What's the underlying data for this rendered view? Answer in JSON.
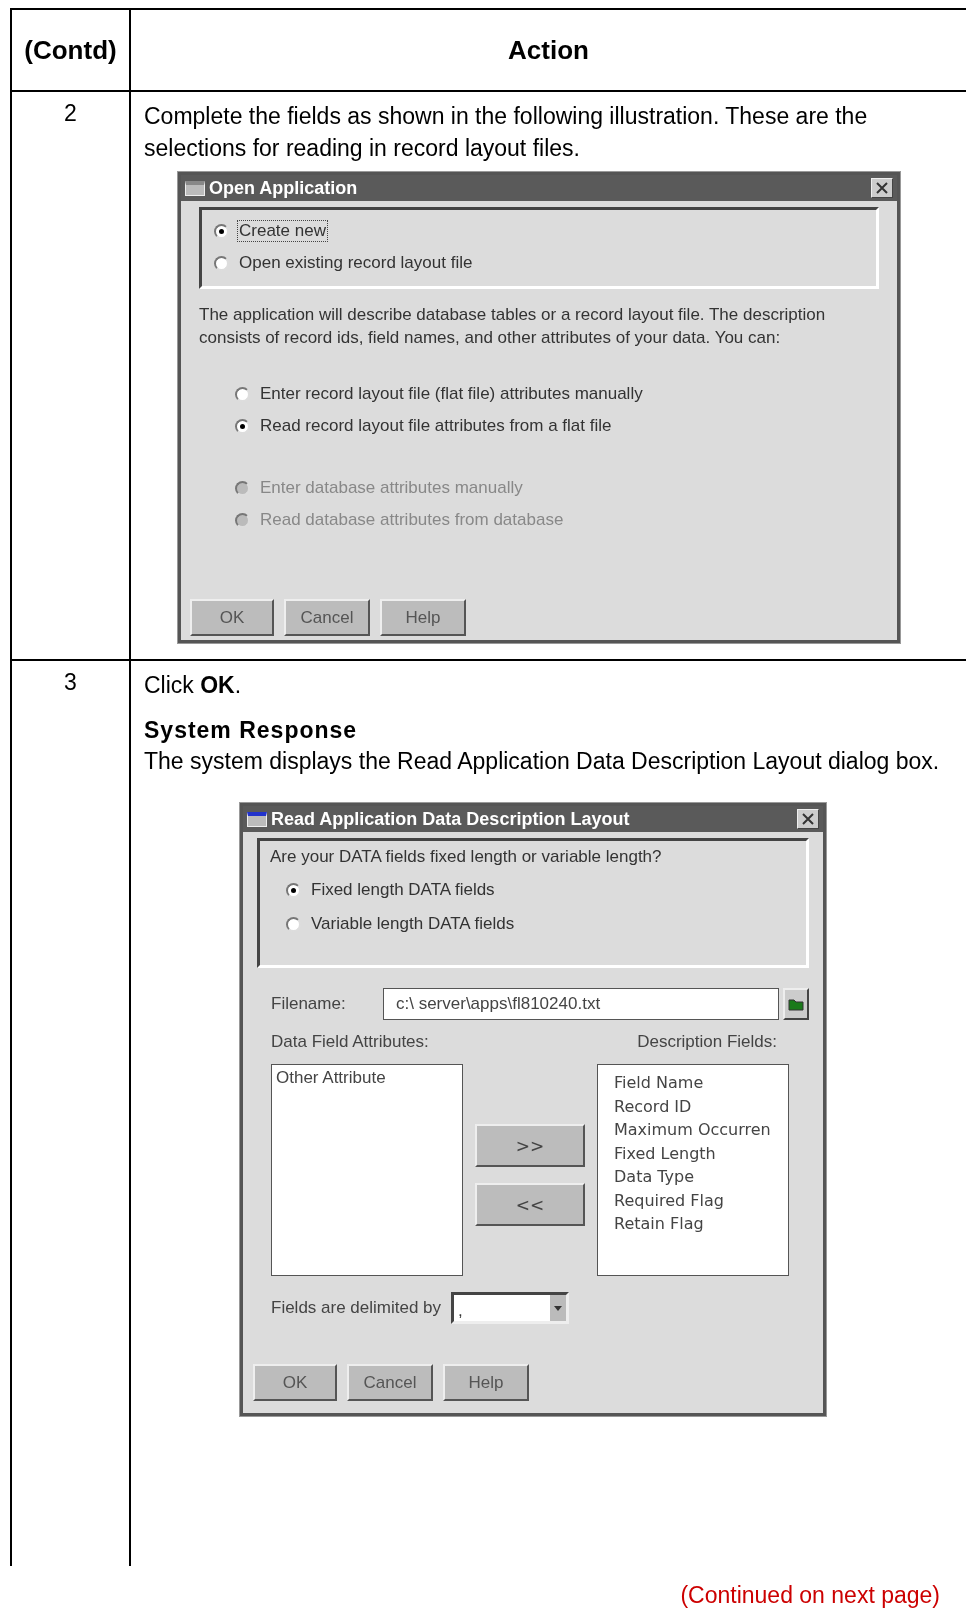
{
  "table": {
    "columns": [
      "(Contd)",
      "Action"
    ],
    "steps": [
      {
        "number": "2",
        "content": [
          {
            "kind": "paragraph",
            "text": "Complete the fields as shown in the following illustration. These are the selections for reading in record layout files."
          },
          {
            "kind": "open_dialog",
            "title": "Open Application",
            "choices": [
              {
                "label": "Create new",
                "selected": true,
                "focused": true
              },
              {
                "label": "Open existing record layout file",
                "selected": false,
                "focused": false
              }
            ],
            "description": "The application will describe database tables or a record layout file.  The description consists of record ids, field names, and other attributes of your data.  You can:",
            "options": [
              {
                "label": "Enter record layout file (flat file) attributes manually",
                "selected": false,
                "disabled": false
              },
              {
                "label": "Read record layout file attributes from a flat file",
                "selected": true,
                "disabled": false
              },
              {
                "label": "Enter database attributes manually",
                "selected": false,
                "disabled": true
              },
              {
                "label": "Read database attributes from database",
                "selected": false,
                "disabled": true
              }
            ],
            "buttons": [
              "OK",
              "Cancel",
              "Help"
            ]
          }
        ]
      },
      {
        "number": "3",
        "content": [
          {
            "kind": "paragraph",
            "text": "Click **OK**."
          },
          {
            "kind": "heading",
            "text": "System Response"
          },
          {
            "kind": "paragraph",
            "text": "The system displays the Read Application Data Description Layout dialog box."
          },
          {
            "kind": "read_dialog",
            "title": "Read Application Data Description Layout",
            "question": "Are your DATA fields fixed length or variable length?",
            "choices": [
              {
                "label": "Fixed length DATA fields",
                "selected": true
              },
              {
                "label": "Variable length DATA fields",
                "selected": false
              }
            ],
            "filename_label": "Filename:",
            "filename": "c:\\  server\\apps\\fl810240.txt",
            "left_label": "Data Field Attributes:",
            "left_items": [
              "Other Attribute"
            ],
            "right_label": "Description Fields:",
            "right_items": [
              "Field Name",
              "Record  ID",
              "Maximum Occurren",
              "Fixed Length",
              "Data Type",
              "Required Flag",
              "Retain Flag"
            ],
            "move_buttons": [
              ">>",
              "<<"
            ],
            "delimiter_label": "Fields are delimited by",
            "delimiter": ",",
            "buttons": [
              "OK",
              "Cancel",
              "Help"
            ]
          }
        ]
      }
    ]
  },
  "footer": "(Continued on next page)"
}
